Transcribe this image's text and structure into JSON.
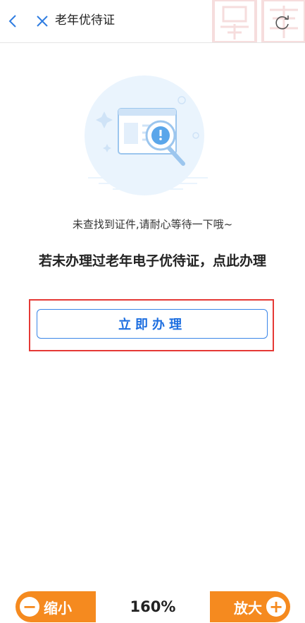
{
  "header": {
    "title": "老年优待证"
  },
  "main": {
    "status_message": "未查找到证件,请耐心等待一下哦~",
    "headline": "若未办理过老年电子优待证，点此办理",
    "apply_button": "立即办理"
  },
  "zoom": {
    "out_label": "缩小",
    "level": "160%",
    "in_label": "放大"
  },
  "colors": {
    "accent_blue": "#1e6fe0",
    "highlight_red": "#e53935",
    "zoom_orange": "#f58a1f"
  }
}
